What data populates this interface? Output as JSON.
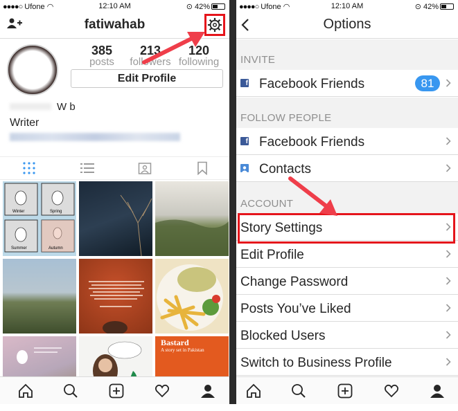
{
  "status_left": {
    "carrier": "Ufone",
    "time": "12:10 AM",
    "battery": "42%"
  },
  "status_right": {
    "carrier": "Ufone",
    "time": "12:10 AM",
    "battery": "42%"
  },
  "profile": {
    "username": "fatiwahab",
    "stats": [
      {
        "value": "385",
        "label": "posts"
      },
      {
        "value": "213",
        "label": "followers"
      },
      {
        "value": "120",
        "label": "following"
      }
    ],
    "edit_button": "Edit Profile",
    "name_partial": "W   b",
    "bio": "Writer"
  },
  "grid_labels": {
    "comic": [
      "Winter",
      "Spring",
      "Summer",
      "Autumn"
    ],
    "book_title": "Bastard",
    "book_subtitle": "A story set in Pakistan"
  },
  "options": {
    "title": "Options",
    "sections": [
      {
        "title": "INVITE",
        "rows": [
          {
            "label": "Facebook Friends",
            "icon": "facebook-icon",
            "badge": "81"
          }
        ]
      },
      {
        "title": "FOLLOW PEOPLE",
        "rows": [
          {
            "label": "Facebook Friends",
            "icon": "facebook-icon"
          },
          {
            "label": "Contacts",
            "icon": "contacts-icon"
          }
        ]
      },
      {
        "title": "ACCOUNT",
        "rows": [
          {
            "label": "Story Settings"
          },
          {
            "label": "Edit Profile"
          },
          {
            "label": "Change Password"
          },
          {
            "label": "Posts You’ve Liked"
          },
          {
            "label": "Blocked Users"
          },
          {
            "label": "Switch to Business Profile"
          }
        ]
      }
    ]
  },
  "colors": {
    "highlight_red": "#e5141b",
    "badge_blue": "#3897f0",
    "facebook_blue": "#3b5998"
  }
}
